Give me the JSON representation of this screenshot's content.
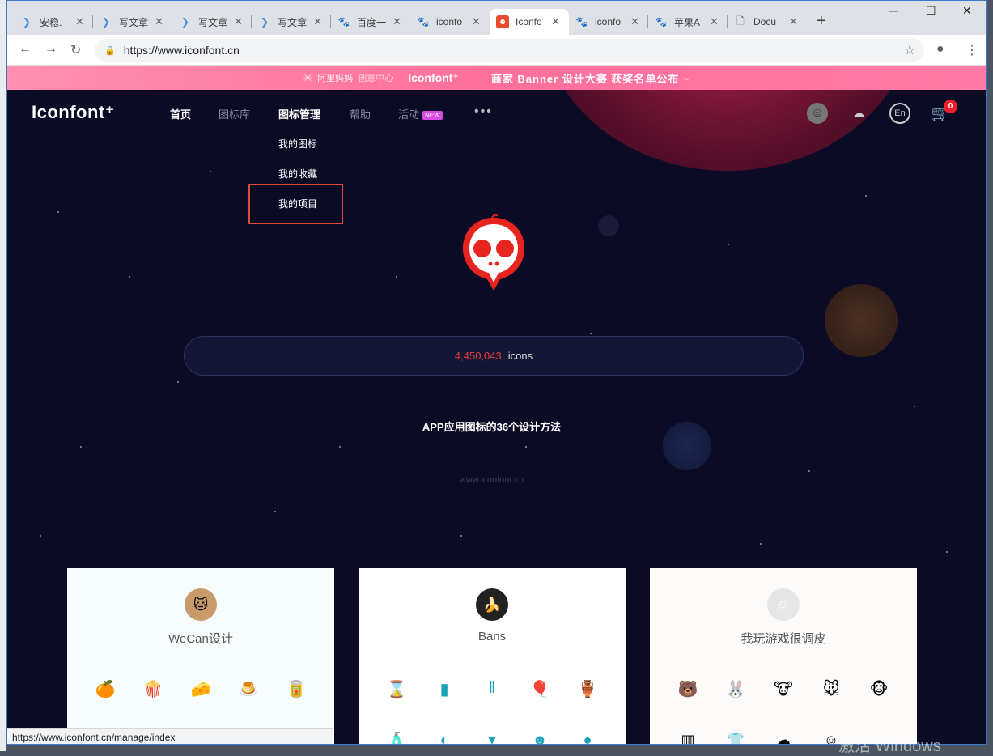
{
  "browser": {
    "tabs": [
      {
        "title": "安稳.",
        "icon": "csdn-icon",
        "active": false
      },
      {
        "title": "写文章",
        "icon": "csdn-icon",
        "active": false
      },
      {
        "title": "写文章",
        "icon": "csdn-icon",
        "active": false
      },
      {
        "title": "写文章",
        "icon": "csdn-icon",
        "active": false
      },
      {
        "title": "百度一",
        "icon": "baidu-icon",
        "active": false
      },
      {
        "title": "iconfo",
        "icon": "baidu-icon",
        "active": false
      },
      {
        "title": "Iconfo",
        "icon": "iconfont-icon",
        "active": true
      },
      {
        "title": "iconfo",
        "icon": "baidu-icon",
        "active": false
      },
      {
        "title": "苹果A",
        "icon": "baidu-icon",
        "active": false
      },
      {
        "title": "Docu",
        "icon": "document-icon",
        "active": false
      }
    ],
    "url": "https://www.iconfont.cn",
    "status_url": "https://www.iconfont.cn/manage/index"
  },
  "banner": {
    "alibaba": "阿里妈妈",
    "creative": "创意中心",
    "brand": "Iconfont⁺",
    "message": "商家 Banner 设计大赛   获奖名单公布 ~"
  },
  "header": {
    "logo": "Iconfont⁺",
    "nav": [
      "首页",
      "图标库",
      "图标管理",
      "帮助",
      "活动"
    ],
    "new_badge": "NEW",
    "more": "•••",
    "cart_count": "0"
  },
  "dropdown": [
    "我的图标",
    "我的收藏",
    "我的项目"
  ],
  "search": {
    "count": "4,450,043",
    "label": "icons"
  },
  "headline": "APP应用图标的36个设计方法",
  "watermark": "www.iconfont.cn",
  "cards": [
    {
      "title": "WeCan设计",
      "avatar": "cat-avatar",
      "icons": [
        "🍊",
        "🍿",
        "🧀",
        "🍮",
        "🥫"
      ],
      "icons2": []
    },
    {
      "title": "Bans",
      "avatar": "banana-avatar",
      "icons": [
        "⌛",
        "▮",
        "‖",
        "🎈",
        "🏺"
      ],
      "icons2": [
        "🧴",
        "◐",
        "▾",
        "☻",
        "●"
      ]
    },
    {
      "title": "我玩游戏很调皮",
      "avatar": "default-avatar",
      "icons": [
        "🐻",
        "🐰",
        "🐮",
        "🐭",
        "🐵"
      ],
      "icons2": [
        "▥",
        "👕",
        "☁",
        "☺",
        ""
      ]
    }
  ],
  "os": {
    "activate_text": "激活 Windows"
  },
  "colors": {
    "page_bg": "#0c0b26",
    "banner": "#ff74a0",
    "highlight_box": "#e14a3a",
    "count": "#e53d3d"
  }
}
